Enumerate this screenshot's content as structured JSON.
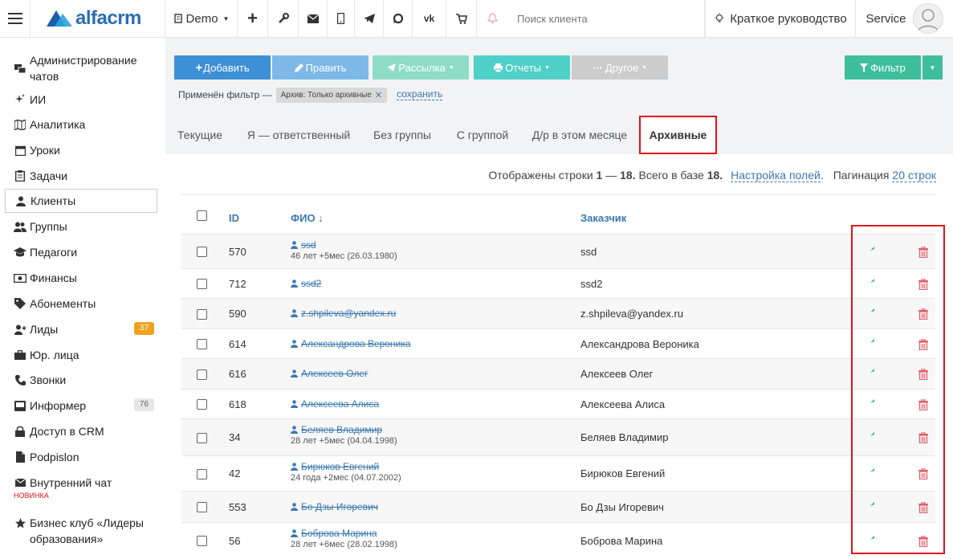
{
  "brand": {
    "name": "alfacrm"
  },
  "topbar": {
    "branch": "Demo",
    "search_placeholder": "Поиск клиента",
    "guide": "Краткое руководство",
    "user": "Service"
  },
  "sidebar": {
    "items": [
      {
        "label": "Администрирование чатов",
        "icon": "chat-admin-icon"
      },
      {
        "label": "ИИ",
        "icon": "ai-sparkle-icon"
      },
      {
        "label": "Аналитика",
        "icon": "map-icon"
      },
      {
        "label": "Уроки",
        "icon": "calendar-icon"
      },
      {
        "label": "Задачи",
        "icon": "clipboard-icon"
      },
      {
        "label": "Клиенты",
        "icon": "user-icon"
      },
      {
        "label": "Группы",
        "icon": "users-icon"
      },
      {
        "label": "Педагоги",
        "icon": "graduation-cap-icon"
      },
      {
        "label": "Финансы",
        "icon": "money-icon"
      },
      {
        "label": "Абонементы",
        "icon": "tag-icon"
      },
      {
        "label": "Лиды",
        "icon": "user-plus-icon",
        "badge": "37"
      },
      {
        "label": "Юр. лица",
        "icon": "briefcase-icon"
      },
      {
        "label": "Звонки",
        "icon": "phone-icon"
      },
      {
        "label": "Информер",
        "icon": "inbox-icon",
        "badge": "76"
      },
      {
        "label": "Доступ в CRM",
        "icon": "lock-icon"
      },
      {
        "label": "Podpislon",
        "icon": "file-icon"
      },
      {
        "label": "Внутренний чат",
        "icon": "envelope-icon",
        "note": "НОВИНКА"
      },
      {
        "label": "Бизнес клуб «Лидеры образования»",
        "icon": "star-icon"
      }
    ]
  },
  "toolbar": {
    "add": "Добавить",
    "edit": "Править",
    "mailing": "Рассылка",
    "reports": "Отчеты",
    "other": "Другое",
    "filter": "Фильтр"
  },
  "filter": {
    "applied_label": "Применён фильтр —",
    "chip": "Архив: Только архивные",
    "save": "сохранить"
  },
  "tabs": [
    "Текущие",
    "Я — ответственный",
    "Без группы",
    "С группой",
    "Д/р в этом месяце",
    "Архивные"
  ],
  "active_tab": "Архивные",
  "summary": {
    "prefix": "Отображены строки",
    "range_start": "1",
    "dash": "—",
    "range_end": "18.",
    "total_label": "Всего в базе",
    "total": "18.",
    "fields_link": "Настройка полей",
    "pagination_label": "Пагинация",
    "pagination_value": "20 строк"
  },
  "table": {
    "headers": {
      "id": "ID",
      "name": "ФИО ↓",
      "customer": "Заказчик"
    },
    "rows": [
      {
        "id": "570",
        "name": "ssd",
        "sub": "46 лет +5мес (26.03.1980)",
        "customer": "ssd"
      },
      {
        "id": "712",
        "name": "ssd2",
        "sub": "",
        "customer": "ssd2"
      },
      {
        "id": "590",
        "name": "z.shpileva@yandex.ru",
        "sub": "",
        "customer": "z.shpileva@yandex.ru"
      },
      {
        "id": "614",
        "name": "Александрова Вероника",
        "sub": "",
        "customer": "Александрова Вероника"
      },
      {
        "id": "616",
        "name": "Алексеев Олег",
        "sub": "",
        "customer": "Алексеев Олег"
      },
      {
        "id": "618",
        "name": "Алексеева Алиса",
        "sub": "",
        "customer": "Алексеева Алиса"
      },
      {
        "id": "34",
        "name": "Беляев Владимир",
        "sub": "28 лет +5мес (04.04.1998)",
        "customer": "Беляев Владимир"
      },
      {
        "id": "42",
        "name": "Бирюков Евгений",
        "sub": "24 года +2мес (04.07.2002)",
        "customer": "Бирюков Евгений"
      },
      {
        "id": "553",
        "name": "Бо Дзы Игоревич",
        "sub": "",
        "customer": "Бо Дзы Игоревич"
      },
      {
        "id": "56",
        "name": "Боброва Марина",
        "sub": "28 лет +6мес (28.02.1998)",
        "customer": "Боброва Марина"
      }
    ]
  },
  "colors": {
    "add": "#3d8fd6",
    "edit": "#7db8e8",
    "mailing": "#8fdcc6",
    "reports": "#4fd0c8",
    "other": "#cccccc",
    "filter": "#3cbf9a",
    "restore": "#2bb08a",
    "delete": "#e0606a",
    "highlight": "#e0141c",
    "link": "#3a78b0"
  }
}
